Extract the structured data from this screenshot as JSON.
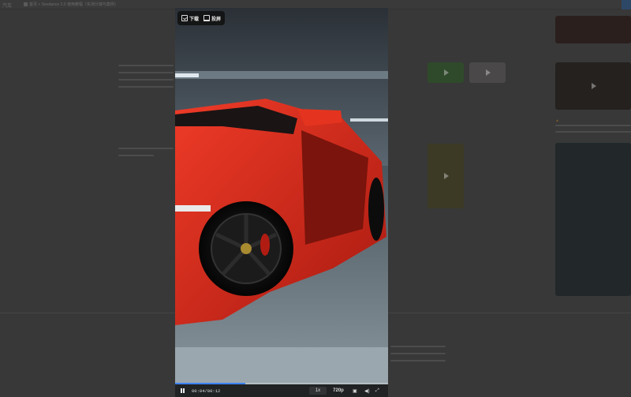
{
  "background": {
    "brand": "汽车",
    "breadcrumb": "首页 > Seedance 2.0 使用教程（实测分镜与案例）",
    "warning_icon": "warning-icon"
  },
  "player": {
    "toolbar": {
      "download_label": "下载",
      "download_icon": "download-icon",
      "cast_label": "投屏",
      "cast_icon": "cast-icon"
    },
    "controls": {
      "time": "00:04/00:12",
      "speed": "1x",
      "quality": "720p",
      "progress": 0.33,
      "pause_icon": "pause-icon",
      "pip_icon": "pip-icon",
      "volume_icon": "volume-icon",
      "fullscreen_icon": "fullscreen-icon"
    }
  },
  "colors": {
    "overlay_dim": "#383838",
    "accent": "#3b82f6",
    "car_red": "#d42a1c"
  }
}
